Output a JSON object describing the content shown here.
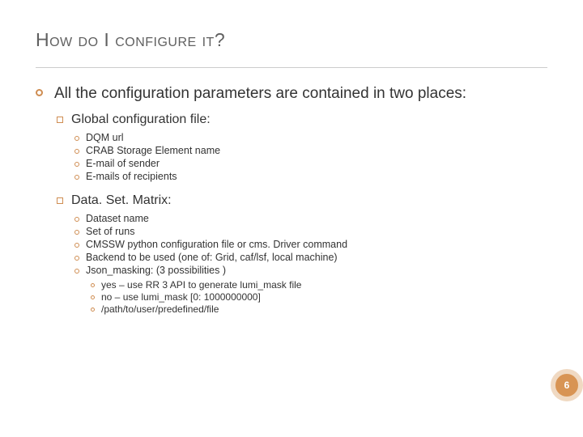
{
  "title": "How do I configure it?",
  "main": {
    "intro": "All the configuration parameters are contained in two places:",
    "sections": [
      {
        "heading": "Global configuration file:",
        "items": [
          "DQM url",
          "CRAB Storage Element name",
          "E-mail of sender",
          "E-mails of recipients"
        ]
      },
      {
        "heading": "Data. Set. Matrix:",
        "items": [
          "Dataset name",
          "Set of runs",
          "CMSSW python configuration file or cms. Driver command",
          "Backend to be used (one of: Grid, caf/lsf, local machine)",
          "Json_masking:   (3 possibilities )"
        ],
        "subitems": [
          "yes – use RR 3 API to generate lumi_mask file",
          "no – use lumi_mask [0: 1000000000]",
          "/path/to/user/predefined/file"
        ]
      }
    ]
  },
  "page_number": "6"
}
